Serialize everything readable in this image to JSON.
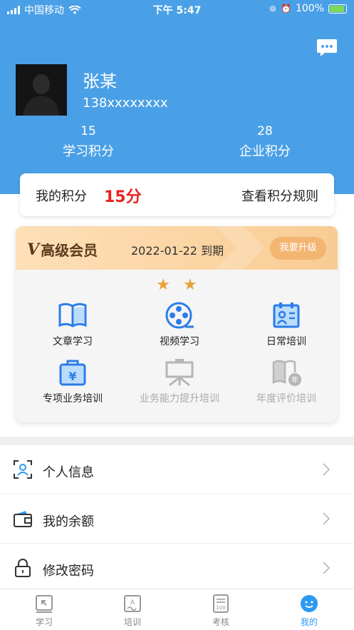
{
  "status_bar": {
    "carrier": "中国移动",
    "time": "下午 5:47",
    "battery": "100%"
  },
  "profile": {
    "name": "张某",
    "phone": "138xxxxxxxx",
    "stats": [
      {
        "value": "15",
        "label": "学习积分"
      },
      {
        "value": "28",
        "label": "企业积分"
      }
    ]
  },
  "points_card": {
    "label": "我的积分",
    "value": "15分",
    "rule_link": "查看积分规则"
  },
  "vip": {
    "badge_letter": "V",
    "badge_text": "高级会员",
    "expiry": "2022-01-22 到期",
    "upgrade_label": "我要升级",
    "stars": "★★",
    "features": [
      {
        "label": "文章学习",
        "icon": "book-icon",
        "enabled": true
      },
      {
        "label": "视频学习",
        "icon": "film-reel-icon",
        "enabled": true
      },
      {
        "label": "日常培训",
        "icon": "daily-training-icon",
        "enabled": true
      },
      {
        "label": "专项业务培训",
        "icon": "yen-briefcase-icon",
        "enabled": true
      },
      {
        "label": "业务能力提升培训",
        "icon": "presentation-board-icon",
        "enabled": false
      },
      {
        "label": "年度评价培训",
        "icon": "annual-book-icon",
        "enabled": false
      }
    ]
  },
  "menu": [
    {
      "label": "个人信息",
      "icon": "personal-info-icon"
    },
    {
      "label": "我的余额",
      "icon": "wallet-icon"
    },
    {
      "label": "修改密码",
      "icon": "lock-icon"
    }
  ],
  "tabbar": [
    {
      "label": "学习",
      "icon": "study-icon"
    },
    {
      "label": "培训",
      "icon": "training-icon"
    },
    {
      "label": "考核",
      "icon": "exam-icon"
    },
    {
      "label": "我的",
      "icon": "profile-face-icon",
      "active": true
    }
  ],
  "colors": {
    "header_blue": "#4aa0e6",
    "accent_red": "#e8231f",
    "vip_gold": "#f3b571",
    "tab_active": "#2b9af3"
  }
}
